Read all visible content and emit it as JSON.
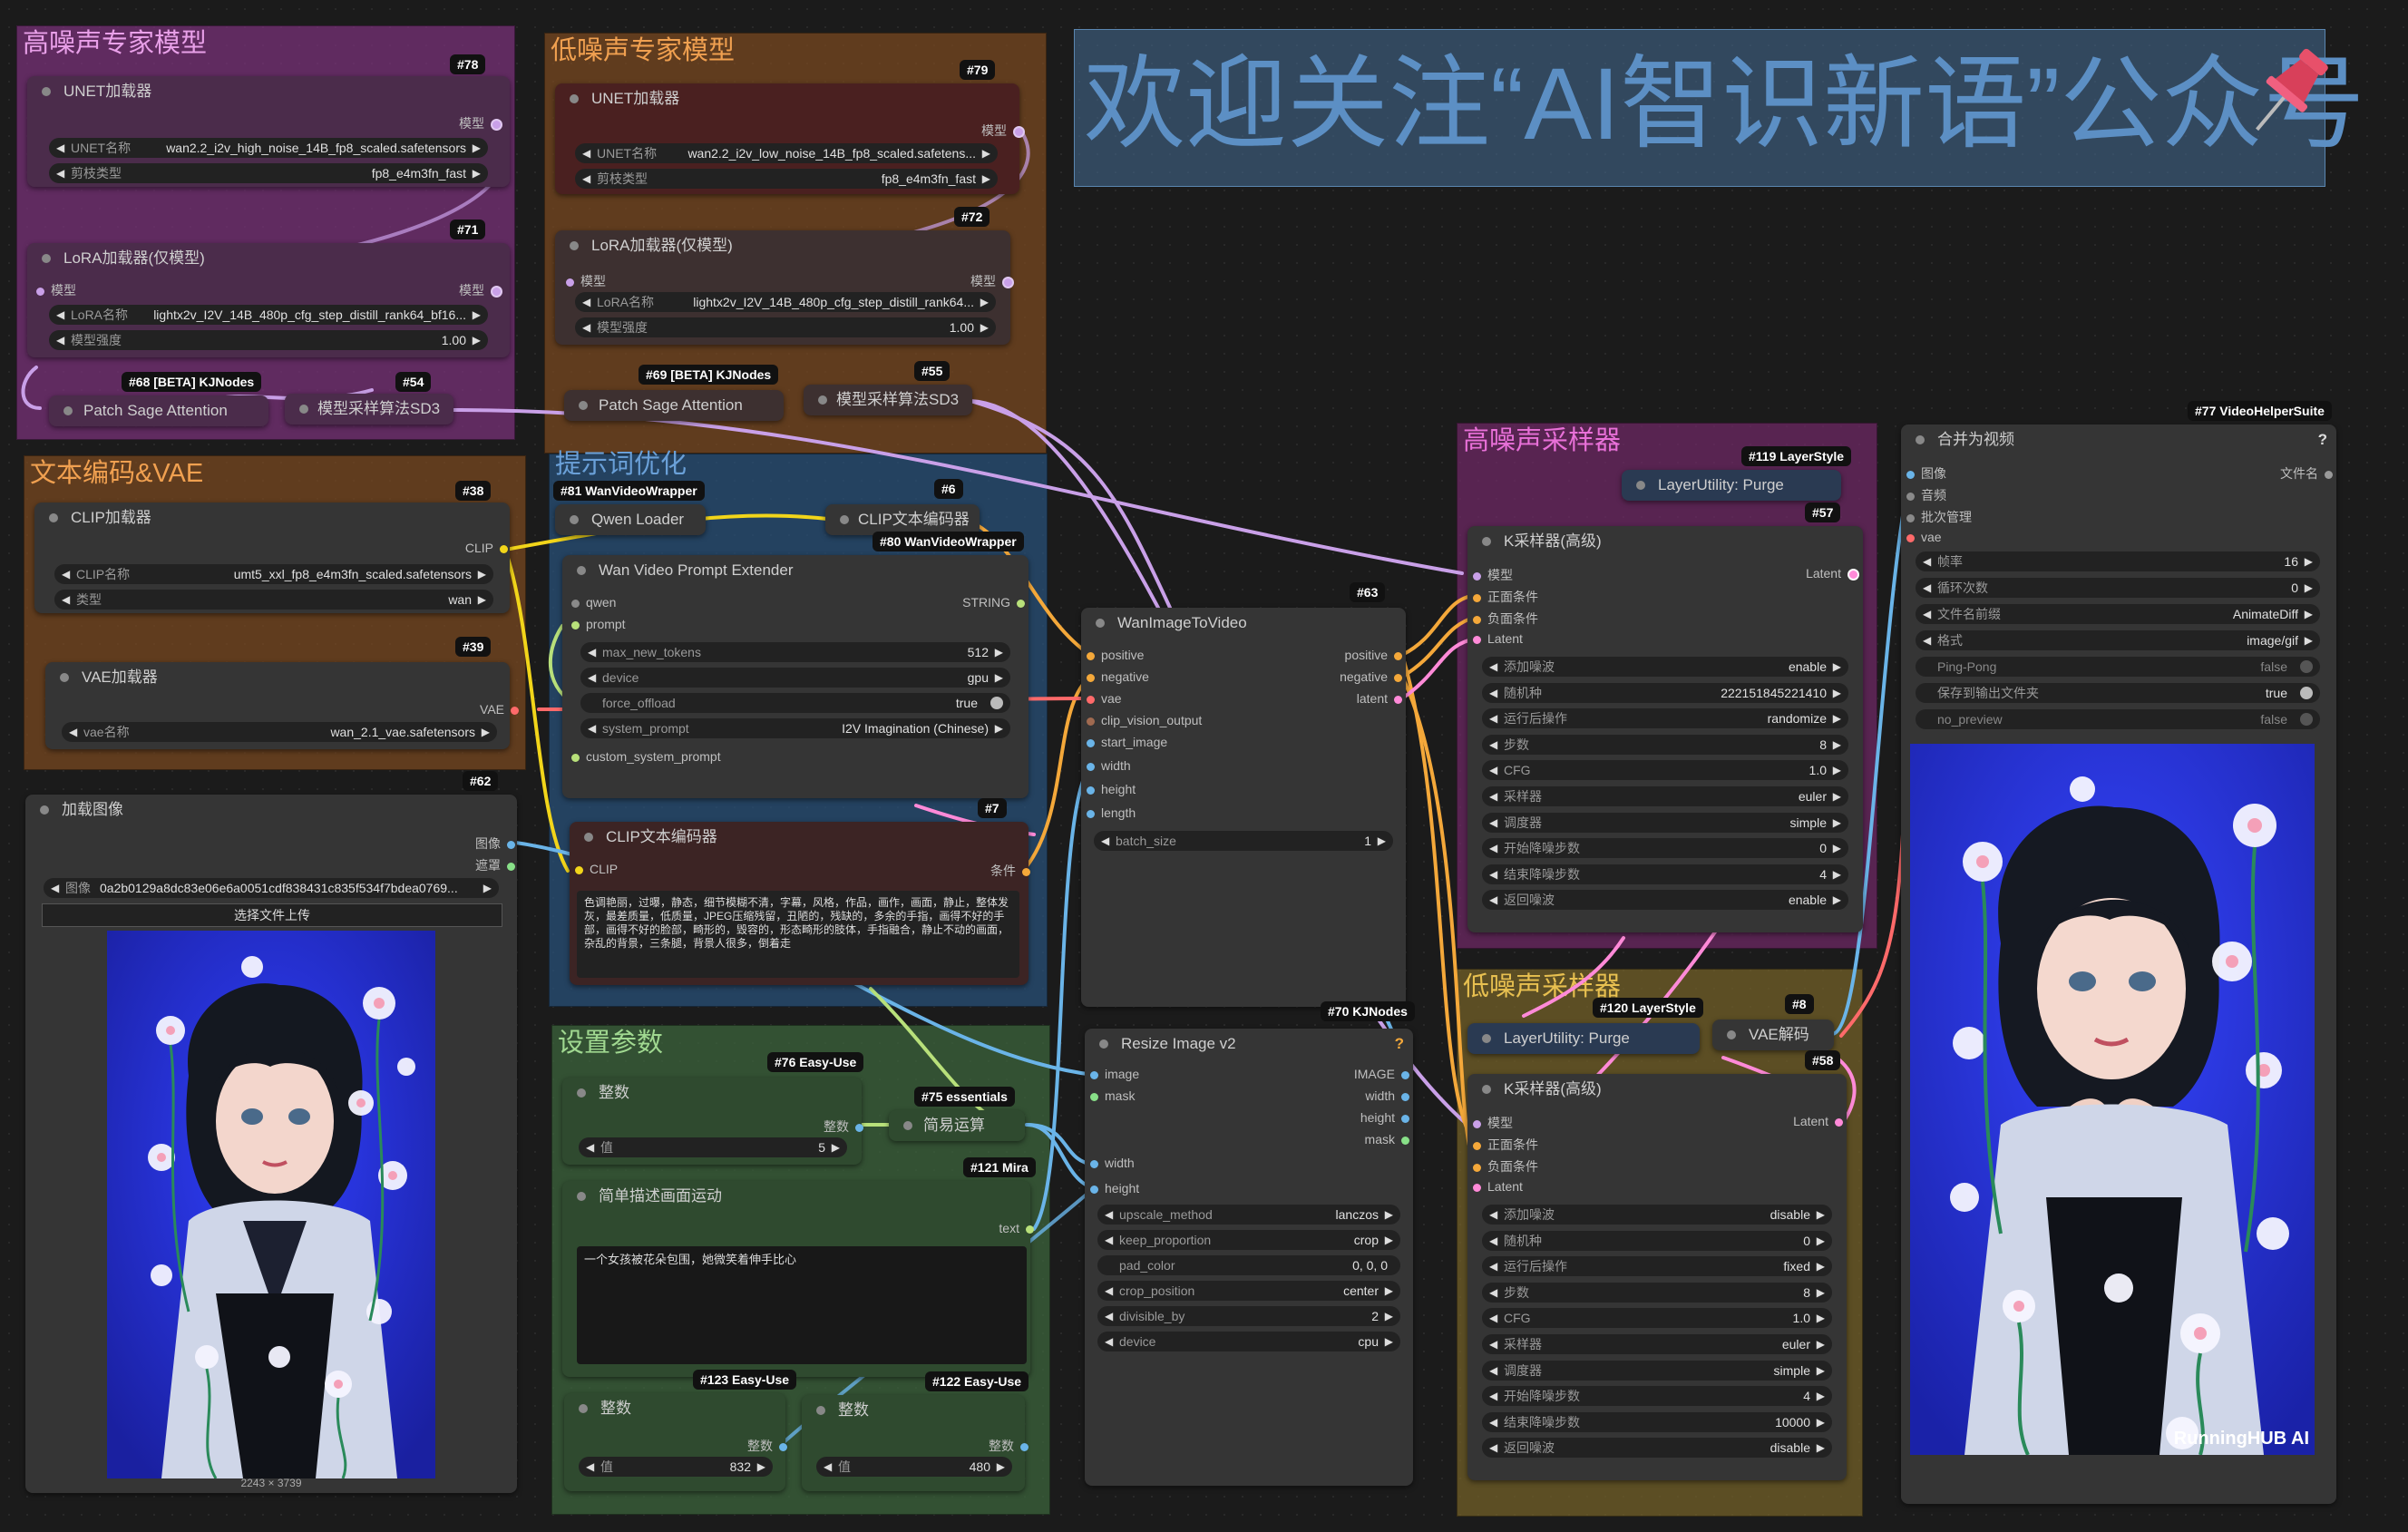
{
  "colors": {
    "wire_purple": "#c9a0e8",
    "wire_orange": "#f4a83a",
    "wire_yellow": "#f2d51a",
    "wire_blue": "#6ab4e8",
    "wire_red": "#ff6a6a",
    "wire_pink": "#ff8ad8",
    "wire_green": "#b8e07a"
  },
  "groups": {
    "high_noise_model": "高噪声专家模型",
    "low_noise_model": "低噪声专家模型",
    "text_vae": "文本编码&VAE",
    "prompt_opt": "提示词优化",
    "settings": "设置参数",
    "high_sampler": "高噪声采样器",
    "low_sampler": "低噪声采样器"
  },
  "banner": "欢迎关注“AI智识新语”公众号",
  "nodes": {
    "unet_high": {
      "badge": "#78",
      "title": "UNET加载器",
      "out_model": "模型",
      "w1_label": "UNET名称",
      "w1_value": "wan2.2_i2v_high_noise_14B_fp8_scaled.safetensors",
      "w2_label": "剪枝类型",
      "w2_value": "fp8_e4m3fn_fast"
    },
    "lora_high": {
      "badge": "#71",
      "title": "LoRA加载器(仅模型)",
      "in_model": "模型",
      "out_model": "模型",
      "w1_label": "LoRA名称",
      "w1_value": "lightx2v_I2V_14B_480p_cfg_step_distill_rank64_bf16...",
      "w2_label": "模型强度",
      "w2_value": "1.00"
    },
    "patch_high": {
      "badge": "#68 [BETA] KJNodes",
      "title": "Patch Sage Attention"
    },
    "sd3_high": {
      "badge": "#54",
      "title": "模型采样算法SD3"
    },
    "unet_low": {
      "badge": "#79",
      "title": "UNET加载器",
      "out_model": "模型",
      "w1_label": "UNET名称",
      "w1_value": "wan2.2_i2v_low_noise_14B_fp8_scaled.safetens...",
      "w2_label": "剪枝类型",
      "w2_value": "fp8_e4m3fn_fast"
    },
    "lora_low": {
      "badge": "#72",
      "title": "LoRA加载器(仅模型)",
      "in_model": "模型",
      "out_model": "模型",
      "w1_label": "LoRA名称",
      "w1_value": "lightx2v_I2V_14B_480p_cfg_step_distill_rank64...",
      "w2_label": "模型强度",
      "w2_value": "1.00"
    },
    "patch_low": {
      "badge": "#69 [BETA] KJNodes",
      "title": "Patch Sage Attention"
    },
    "sd3_low": {
      "badge": "#55",
      "title": "模型采样算法SD3"
    },
    "clip_loader": {
      "badge": "#38",
      "title": "CLIP加载器",
      "out": "CLIP",
      "w1_label": "CLIP名称",
      "w1_value": "umt5_xxl_fp8_e4m3fn_scaled.safetensors",
      "w2_label": "类型",
      "w2_value": "wan"
    },
    "vae_loader": {
      "badge": "#39",
      "title": "VAE加载器",
      "out": "VAE",
      "w1_label": "vae名称",
      "w1_value": "wan_2.1_vae.safetensors"
    },
    "load_image": {
      "badge": "#62",
      "title": "加载图像",
      "out1": "图像",
      "out2": "遮罩",
      "w1_label": "图像",
      "w1_value": "0a2b0129a8dc83e06e6a0051cdf838431c835f534f7bdea0769...",
      "upload": "选择文件上传",
      "dims": "2243 × 3739"
    },
    "qwen_loader": {
      "badge": "#81 WanVideoWrapper",
      "title": "Qwen Loader"
    },
    "clip_enc_pos": {
      "badge": "#6",
      "title": "CLIP文本编码器"
    },
    "prompt_ext": {
      "badge": "#80 WanVideoWrapper",
      "title": "Wan Video Prompt Extender",
      "in1": "qwen",
      "in2": "prompt",
      "out": "STRING",
      "in3": "custom_system_prompt",
      "w": [
        {
          "l": "max_new_tokens",
          "v": "512"
        },
        {
          "l": "device",
          "v": "gpu"
        }
      ],
      "toggle": {
        "l": "force_offload",
        "v": "true"
      },
      "w_sys": {
        "l": "system_prompt",
        "v": "I2V Imagination (Chinese)"
      }
    },
    "clip_enc_neg": {
      "badge": "#7",
      "title": "CLIP文本编码器",
      "in": "CLIP",
      "out": "条件",
      "text": "色调艳丽，过曝，静态，细节模糊不清，字幕，风格，作品，画作，画面，静止，整体发灰，最差质量，低质量，JPEG压缩残留，丑陋的，残缺的，多余的手指，画得不好的手部，画得不好的脸部，畸形的，毁容的，形态畸形的肢体，手指融合，静止不动的画面，杂乱的背景，三条腿，背景人很多，倒着走"
    },
    "wan_i2v": {
      "badge": "#63",
      "title": "WanImageToVideo",
      "in": [
        "positive",
        "negative",
        "vae",
        "clip_vision_output",
        "start_image",
        "width",
        "height",
        "length"
      ],
      "out": [
        "positive",
        "negative",
        "latent"
      ],
      "w_label": "batch_size",
      "w_value": "1"
    },
    "int_76": {
      "badge": "#76 Easy-Use",
      "title": "整数",
      "out": "整数",
      "w_label": "值",
      "w_value": "5"
    },
    "simple_calc": {
      "badge": "#75 essentials",
      "title": "简易运算"
    },
    "motion_desc": {
      "badge": "#121 Mira",
      "title": "简单描述画面运动",
      "out": "text",
      "text": "一个女孩被花朵包围，她微笑着伸手比心"
    },
    "int_123": {
      "badge": "#123 Easy-Use",
      "title": "整数",
      "out": "整数",
      "w_label": "值",
      "w_value": "832"
    },
    "int_122": {
      "badge": "#122 Easy-Use",
      "title": "整数",
      "out": "整数",
      "w_label": "值",
      "w_value": "480"
    },
    "resize": {
      "badge": "#70 KJNodes",
      "title": "Resize Image v2",
      "in": [
        "image",
        "mask"
      ],
      "out": [
        "IMAGE",
        "width",
        "height",
        "mask"
      ],
      "in2": [
        "width",
        "height"
      ],
      "w": [
        {
          "l": "upscale_method",
          "v": "lanczos"
        },
        {
          "l": "keep_proportion",
          "v": "crop"
        },
        {
          "l": "pad_color",
          "v": "0, 0, 0"
        },
        {
          "l": "crop_position",
          "v": "center"
        },
        {
          "l": "divisible_by",
          "v": "2"
        },
        {
          "l": "device",
          "v": "cpu"
        }
      ]
    },
    "purge_high": {
      "badge": "#119 LayerStyle",
      "title": "LayerUtility: Purge"
    },
    "ksampler_high": {
      "badge": "#57",
      "title": "K采样器(高级)",
      "in": [
        "模型",
        "正面条件",
        "负面条件",
        "Latent"
      ],
      "out": "Latent",
      "w": [
        {
          "l": "添加噪波",
          "v": "enable"
        },
        {
          "l": "随机种",
          "v": "222151845221410"
        },
        {
          "l": "运行后操作",
          "v": "randomize"
        },
        {
          "l": "步数",
          "v": "8"
        },
        {
          "l": "CFG",
          "v": "1.0"
        },
        {
          "l": "采样器",
          "v": "euler"
        },
        {
          "l": "调度器",
          "v": "simple"
        },
        {
          "l": "开始降噪步数",
          "v": "0"
        },
        {
          "l": "结束降噪步数",
          "v": "4"
        },
        {
          "l": "返回噪波",
          "v": "enable"
        }
      ]
    },
    "purge_low": {
      "badge": "#120 LayerStyle",
      "title": "LayerUtility: Purge"
    },
    "vae_decode": {
      "badge": "#8",
      "title": "VAE解码"
    },
    "ksampler_low": {
      "badge": "#58",
      "title": "K采样器(高级)",
      "in": [
        "模型",
        "正面条件",
        "负面条件",
        "Latent"
      ],
      "out": "Latent",
      "w": [
        {
          "l": "添加噪波",
          "v": "disable"
        },
        {
          "l": "随机种",
          "v": "0"
        },
        {
          "l": "运行后操作",
          "v": "fixed"
        },
        {
          "l": "步数",
          "v": "8"
        },
        {
          "l": "CFG",
          "v": "1.0"
        },
        {
          "l": "采样器",
          "v": "euler"
        },
        {
          "l": "调度器",
          "v": "simple"
        },
        {
          "l": "开始降噪步数",
          "v": "4"
        },
        {
          "l": "结束降噪步数",
          "v": "10000"
        },
        {
          "l": "返回噪波",
          "v": "disable"
        }
      ]
    },
    "video_combine": {
      "badge": "#77 VideoHelperSuite",
      "title": "合并为视频",
      "help": "?",
      "in": [
        "图像",
        "音频",
        "批次管理",
        "vae"
      ],
      "out": "文件名",
      "w": [
        {
          "l": "帧率",
          "v": "16"
        },
        {
          "l": "循环次数",
          "v": "0"
        },
        {
          "l": "文件名前缀",
          "v": "AnimateDiff"
        },
        {
          "l": "格式",
          "v": "image/gif"
        }
      ],
      "toggles": [
        {
          "l": "Ping-Pong",
          "v": "false"
        },
        {
          "l": "保存到输出文件夹",
          "v": "true"
        },
        {
          "l": "no_preview",
          "v": "false"
        }
      ],
      "watermark": "RunningHUB AI"
    }
  }
}
